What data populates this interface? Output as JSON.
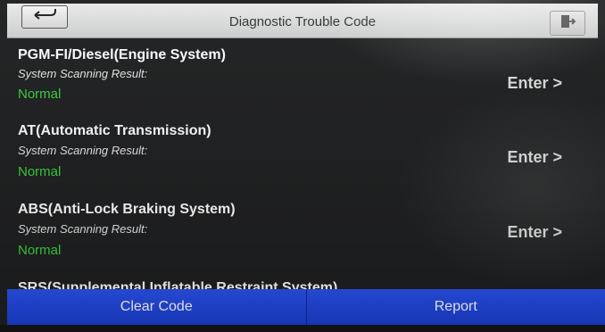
{
  "header": {
    "title": "Diagnostic Trouble Code",
    "back_icon": "return-arrow-icon",
    "exit_icon": "exit-door-icon"
  },
  "systems": [
    {
      "title": "PGM-FI/Diesel(Engine System)",
      "sub": "System Scanning Result:",
      "status": "Normal",
      "action": "Enter >"
    },
    {
      "title": "AT(Automatic Transmission)",
      "sub": "System Scanning Result:",
      "status": "Normal",
      "action": "Enter >"
    },
    {
      "title": "ABS(Anti-Lock Braking System)",
      "sub": "System Scanning Result:",
      "status": "Normal",
      "action": "Enter >"
    }
  ],
  "partial_item": {
    "title": "SRS(Supplemental Inflatable Restraint System)"
  },
  "footer": {
    "clear_label": "Clear Code",
    "report_label": "Report"
  },
  "colors": {
    "status_ok": "#39d23c",
    "button_blue": "#1a3fd3",
    "header_bg": "#dcdcdc"
  }
}
